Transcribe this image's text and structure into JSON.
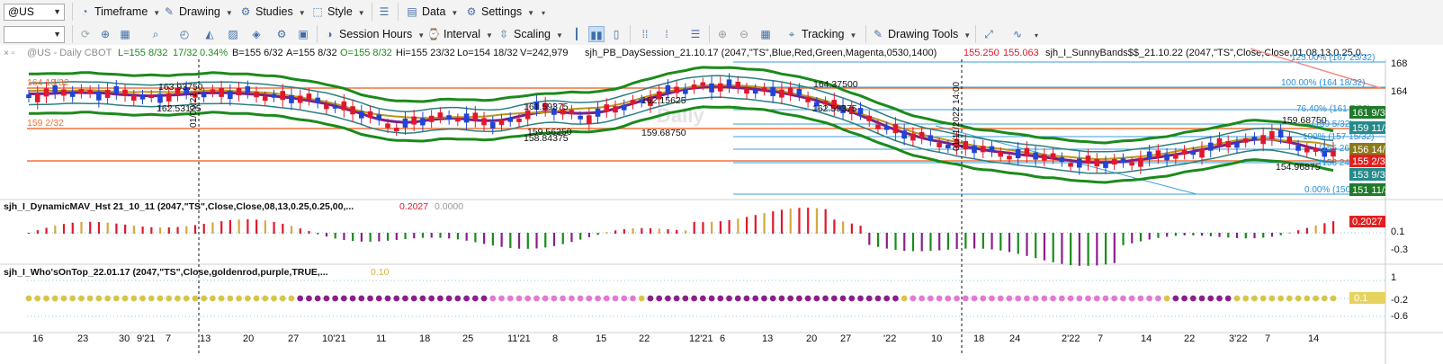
{
  "toolbar1": {
    "symbol": "@US",
    "timeframe": "Timeframe",
    "drawing": "Drawing",
    "studies": "Studies",
    "style": "Style",
    "data": "Data",
    "settings": "Settings"
  },
  "toolbar2": {
    "session_hours": "Session Hours",
    "interval": "Interval",
    "scaling": "Scaling",
    "tracking": "Tracking",
    "drawing_tools": "Drawing Tools"
  },
  "chart_header": {
    "symbol_info": "@US - Daily  CBOT",
    "last": "L=155 8/32",
    "change": "17/32",
    "change_pct": "0.34%",
    "bid": "B=155 6/32",
    "ask": "A=155 8/32",
    "open": "O=155 8/32",
    "high": "Hi=155 23/32",
    "low": "Lo=154 18/32",
    "volume": "V=242,979",
    "study1": "sjh_PB_DaySession_21.10.17 (2047,\"TS\",Blue,Red,Green,Magenta,0530,1400)",
    "study1_val_red": "155.250",
    "study1_val2": "155.063",
    "study2": "sjh_I_SunnyBands$$_21.10.22 (2047,\"TS\",Close,Close,01,08,13,0.25,0..."
  },
  "price_axis": [
    "168",
    "164",
    "161 9/32",
    "159 11/32",
    "156 14/32",
    "155 2/32",
    "153 9/32",
    "151 11/32"
  ],
  "price_annotations": [
    "164 18/32",
    "159 2/32",
    "163.93750",
    "162.53125",
    "161.59375",
    "159.56250",
    "158.84375",
    "162.15625",
    "159.68750",
    "164.37500",
    "162.59375",
    "159.68750",
    "154.96875"
  ],
  "fib_labels": [
    "125.00% (167 25/32)",
    "100.00% (164 18/32)",
    "76.40% (161 7/32)",
    "(159 5/32)",
    "100% (157 15/32)",
    "(155 26/32)",
    "(153 24/32)",
    "0.00% (150 12/32)"
  ],
  "panel2": {
    "title": "sjh_I_DynamicMAV_Hst 21_10_11 (2047,\"TS\",Close,Close,08,13,0.25,0.25,00,...",
    "value_red": "0.2027",
    "value_grey": "0.0000",
    "axis": [
      "0.1",
      "-0.3"
    ],
    "last_badge": "0.2027"
  },
  "panel3": {
    "title": "sjh_I_Who'sOnTop_22.01.17 (2047,\"TS\",Close,goldenrod,purple,TRUE,...",
    "value": "0.10",
    "axis": [
      "1",
      "-0.2",
      "-0.6"
    ],
    "last_badge": "0.1"
  },
  "time_axis": [
    "16",
    "23",
    "30",
    "9'21",
    "7",
    "13",
    "20",
    "27",
    "10'21",
    "11",
    "18",
    "25",
    "11'21",
    "8",
    "15",
    "22",
    "12'21",
    "6",
    "13",
    "20",
    "27",
    "'22",
    "10",
    "18",
    "24",
    "2'22",
    "7",
    "14",
    "22",
    "3'22",
    "7",
    "14"
  ],
  "vertical_markers": [
    "01/09/21",
    "01/11/2022 14:00"
  ],
  "watermark": "Daily",
  "colors": {
    "accent": "#3e6ea8",
    "up_candle": "#1f44d6",
    "down_candle": "#e0182c",
    "band_green": "#1b8a1b",
    "band_teal": "#2c7f7f",
    "ma_purple": "#7a1f8a",
    "ma_gold": "#b8961e",
    "badge_green": "#1f7a2a",
    "badge_teal": "#258a8a",
    "badge_red": "#e02020",
    "badge_olive": "#8a7a1a"
  }
}
